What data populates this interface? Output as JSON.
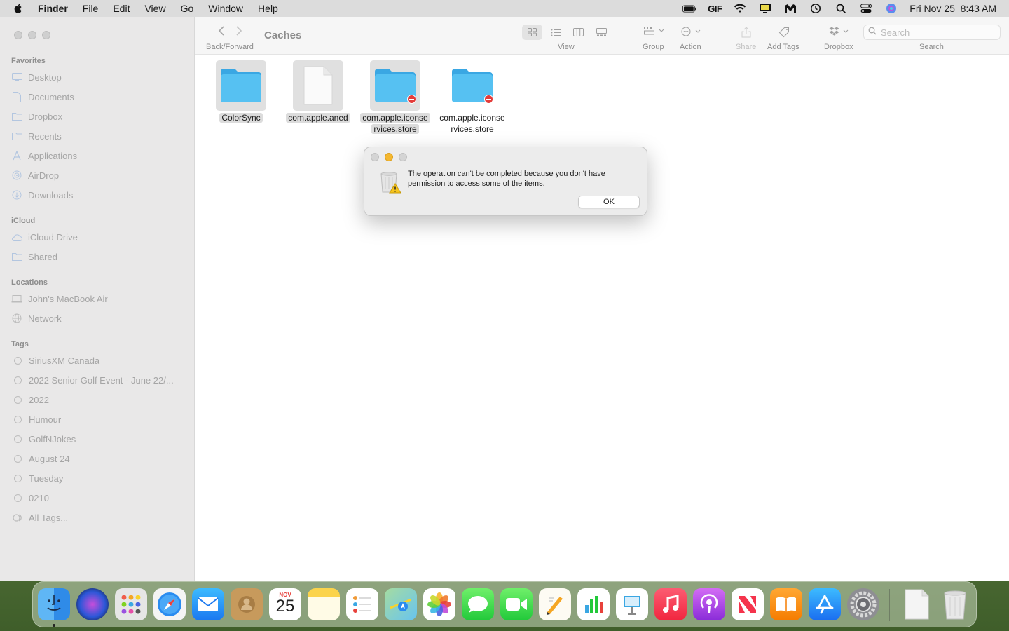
{
  "menubar": {
    "app_name": "Finder",
    "menus": [
      "File",
      "Edit",
      "View",
      "Go",
      "Window",
      "Help"
    ],
    "status_text": "GIF",
    "datetime": "Fri Nov 25  8:43 AM"
  },
  "toolbar": {
    "title": "Caches",
    "back_forward_label": "Back/Forward",
    "view_label": "View",
    "group_label": "Group",
    "action_label": "Action",
    "share_label": "Share",
    "add_tags_label": "Add Tags",
    "dropbox_label": "Dropbox",
    "search_label": "Search",
    "search_placeholder": "Search"
  },
  "sidebar": {
    "favorites_header": "Favorites",
    "favorites": [
      "Desktop",
      "Documents",
      "Dropbox",
      "Recents",
      "Applications",
      "AirDrop",
      "Downloads"
    ],
    "icloud_header": "iCloud",
    "icloud": [
      "iCloud Drive",
      "Shared"
    ],
    "locations_header": "Locations",
    "locations": [
      "John's MacBook Air",
      "Network"
    ],
    "tags_header": "Tags",
    "tags": [
      "SiriusXM Canada",
      "2022 Senior Golf Event - June 22/...",
      "2022",
      "Humour",
      "GolfNJokes",
      "August 24",
      "Tuesday",
      "0210",
      "All Tags..."
    ]
  },
  "files": [
    {
      "name": "ColorSync",
      "kind": "folder",
      "selected": true,
      "badge": false
    },
    {
      "name": "com.apple.aned",
      "kind": "document",
      "selected": true,
      "badge": false
    },
    {
      "name_line1": "com.apple.iconse",
      "name_line2": "rvices.store",
      "kind": "folder",
      "selected": true,
      "badge": true
    },
    {
      "name_line1": "com.apple.iconse",
      "name_line2": "rvices.store",
      "kind": "folder",
      "selected": false,
      "badge": true
    }
  ],
  "dialog": {
    "message": "The operation can't be completed because you don't have permission to access some of the items.",
    "ok_label": "OK"
  },
  "dock": {
    "calendar_month": "NOV",
    "calendar_day": "25"
  },
  "colors": {
    "folder_blue": "#4bb8ee",
    "badge_red": "#e43c3a",
    "minimize_yellow": "#f4b72f"
  }
}
